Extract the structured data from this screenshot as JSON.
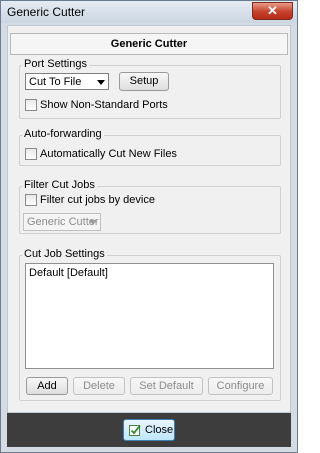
{
  "window": {
    "title": "Generic Cutter",
    "close_glyph": "✕"
  },
  "header": {
    "title": "Generic Cutter"
  },
  "port_settings": {
    "title": "Port Settings",
    "port_value": "Cut To File",
    "setup_label": "Setup",
    "non_standard_label": "Show Non-Standard Ports",
    "non_standard_checked": false
  },
  "auto_forwarding": {
    "title": "Auto-forwarding",
    "auto_cut_label": "Automatically Cut New Files",
    "auto_cut_checked": false
  },
  "filter_cut_jobs": {
    "title": "Filter Cut Jobs",
    "filter_label": "Filter cut jobs by device",
    "filter_checked": false,
    "device_value": "Generic Cutter"
  },
  "cut_job_settings": {
    "title": "Cut Job Settings",
    "items": [
      "Default [Default]"
    ],
    "buttons": {
      "add": "Add",
      "delete": "Delete",
      "set_default": "Set Default",
      "configure": "Configure"
    }
  },
  "footer": {
    "close_label": "Close",
    "close_icon": "check-icon"
  }
}
